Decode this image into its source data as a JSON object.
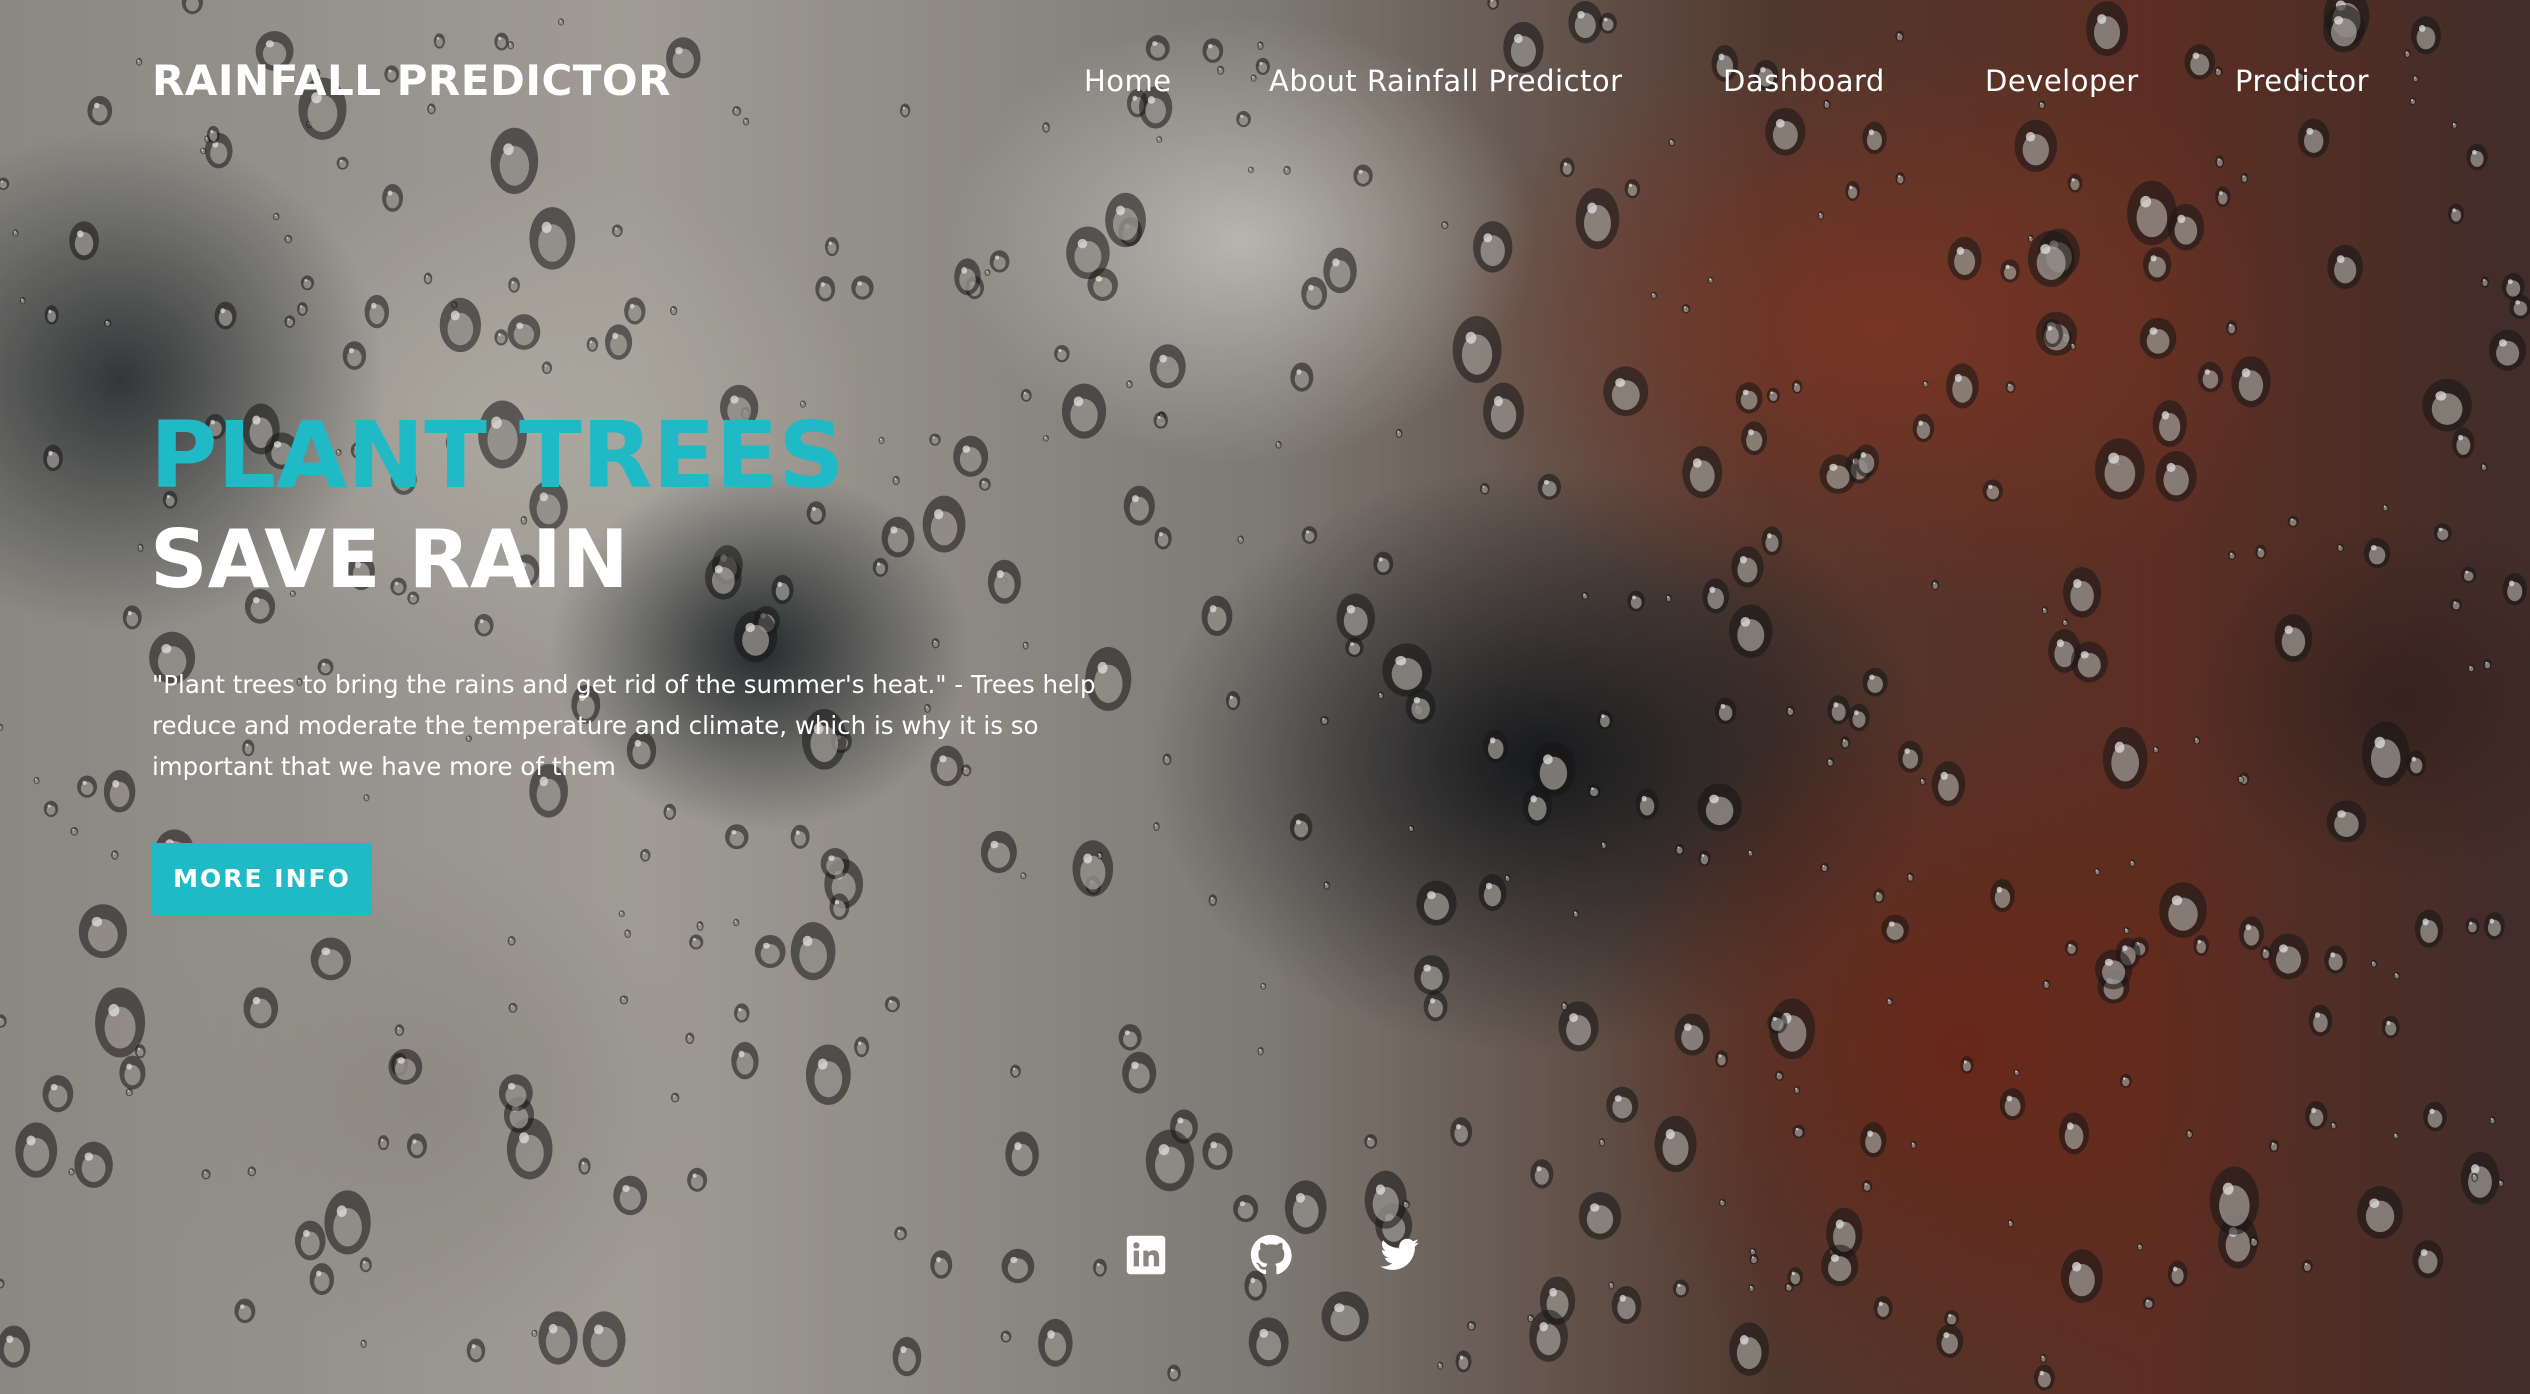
{
  "navbar": {
    "brand": "RAINFALL PREDICTOR",
    "links": [
      "Home",
      "About Rainfall Predictor",
      "Dashboard",
      "Developer",
      "Predictor"
    ]
  },
  "hero": {
    "title_line1": "PLANT TREES",
    "title_line2": "SAVE RAIN",
    "paragraph": "\"Plant trees to bring the rains and get rid of the summer's heat.\" - Trees help reduce and moderate the temperature and climate, which is why it is so important that we have more of them",
    "button_label": "MORE INFO"
  },
  "social": {
    "icons": [
      "linkedin-icon",
      "github-icon",
      "twitter-icon"
    ]
  },
  "colors": {
    "accent": "#1fbac6",
    "text": "#ffffff"
  }
}
